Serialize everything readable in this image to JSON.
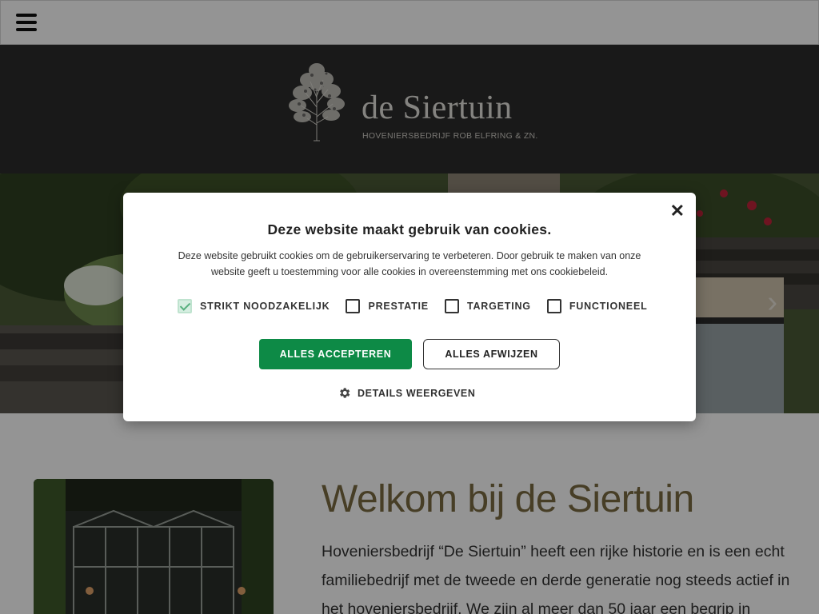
{
  "header": {
    "menu_icon": "hamburger-menu-icon"
  },
  "banner": {
    "logo_title": "de Siertuin",
    "logo_subtitle": "HOVENIERSBEDRIJF ROB ELFRING & ZN.",
    "logo_icon": "tree-icon"
  },
  "hero": {
    "next_icon": "chevron-right-icon"
  },
  "content": {
    "title": "Welkom bij de Siertuin",
    "text": "Hoveniersbedrijf “De Siertuin” heeft een rijke historie en is een echt familiebedrijf met de tweede en derde generatie nog steeds actief in het hoveniersbedrijf. We zijn al meer dan 50 jaar een begrip in"
  },
  "cookie": {
    "title": "Deze website maakt gebruik van cookies.",
    "text": "Deze website gebruikt cookies om de gebruikerservaring te verbeteren. Door gebruik te maken van onze website geeft u toestemming voor alle cookies in overeenstemming met ons cookiebeleid.",
    "options": [
      {
        "label": "STRIKT NOODZAKELIJK",
        "checked": true
      },
      {
        "label": "PRESTATIE",
        "checked": false
      },
      {
        "label": "TARGETING",
        "checked": false
      },
      {
        "label": "FUNCTIONEEL",
        "checked": false
      }
    ],
    "accept_label": "ALLES ACCEPTEREN",
    "decline_label": "ALLES AFWIJZEN",
    "details_label": "DETAILS WEERGEVEN",
    "close_icon": "close-icon",
    "accent_color": "#0d8a46"
  }
}
